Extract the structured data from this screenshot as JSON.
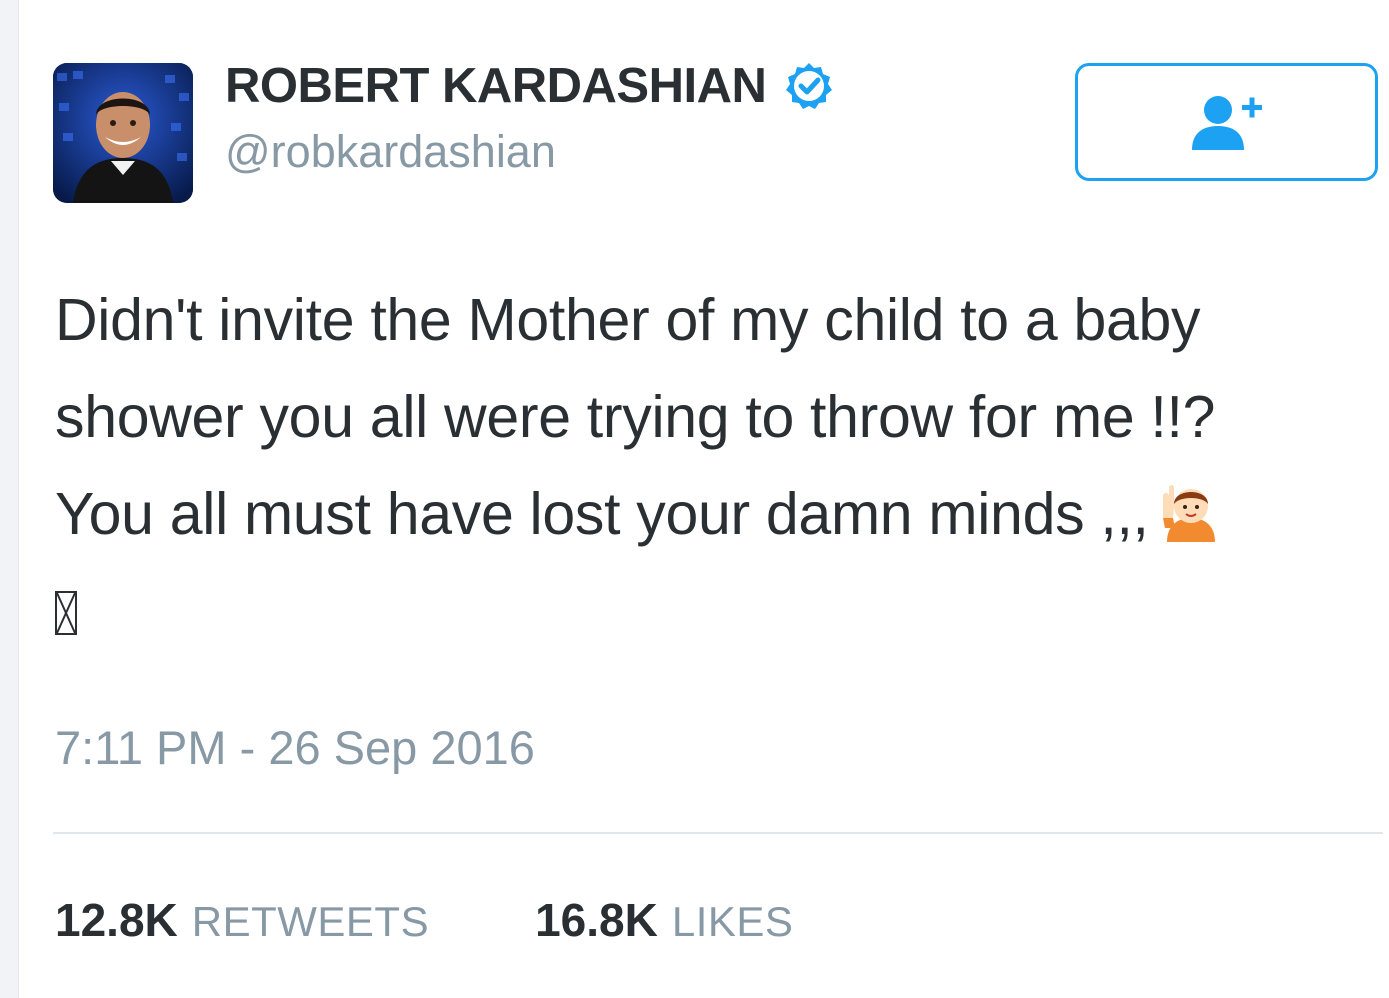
{
  "tweet": {
    "author": {
      "display_name": "ROBERT KARDASHIAN",
      "handle": "@robkardashian",
      "verified": true,
      "avatar_icon": "profile-photo"
    },
    "follow_button": {
      "icon": "add-user-icon",
      "color": "#1da1f2"
    },
    "text_lines": [
      "Didn't invite the Mother of my child to a baby",
      "shower you all were trying to throw for me !!?",
      "You all must have lost your damn minds ,,,"
    ],
    "emoji": "raising-hand-emoji",
    "missing_glyph": "unrendered-emoji-box",
    "timestamp": "7:11 PM - 26 Sep 2016",
    "stats": {
      "retweets_count": "12.8K",
      "retweets_label": "RETWEETS",
      "likes_count": "16.8K",
      "likes_label": "LIKES"
    }
  },
  "colors": {
    "text": "#292f33",
    "secondary": "#8899a6",
    "accent": "#1da1f2",
    "divider": "#e1e8ed"
  }
}
